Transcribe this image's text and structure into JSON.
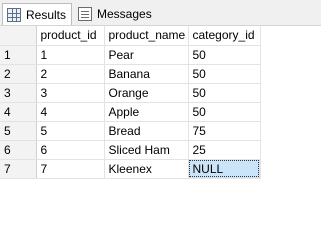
{
  "tabs": [
    {
      "label": "Results",
      "icon": "grid-icon",
      "active": true
    },
    {
      "label": "Messages",
      "icon": "messages-icon",
      "active": false
    }
  ],
  "grid": {
    "columns": [
      "",
      "product_id",
      "product_name",
      "category_id"
    ],
    "rows": [
      {
        "row_num": "1",
        "product_id": "1",
        "product_name": "Pear",
        "category_id": "50"
      },
      {
        "row_num": "2",
        "product_id": "2",
        "product_name": "Banana",
        "category_id": "50"
      },
      {
        "row_num": "3",
        "product_id": "3",
        "product_name": "Orange",
        "category_id": "50"
      },
      {
        "row_num": "4",
        "product_id": "4",
        "product_name": "Apple",
        "category_id": "50"
      },
      {
        "row_num": "5",
        "product_id": "5",
        "product_name": "Bread",
        "category_id": "75"
      },
      {
        "row_num": "6",
        "product_id": "6",
        "product_name": "Sliced Ham",
        "category_id": "25"
      },
      {
        "row_num": "7",
        "product_id": "7",
        "product_name": "Kleenex",
        "category_id": "NULL"
      }
    ],
    "selected_cell": {
      "row_index": 6,
      "column": "category_id"
    }
  },
  "colors": {
    "selection": "#cce4f7",
    "header_bg": "#f3f3f3",
    "gridline": "#e3e3e3"
  }
}
